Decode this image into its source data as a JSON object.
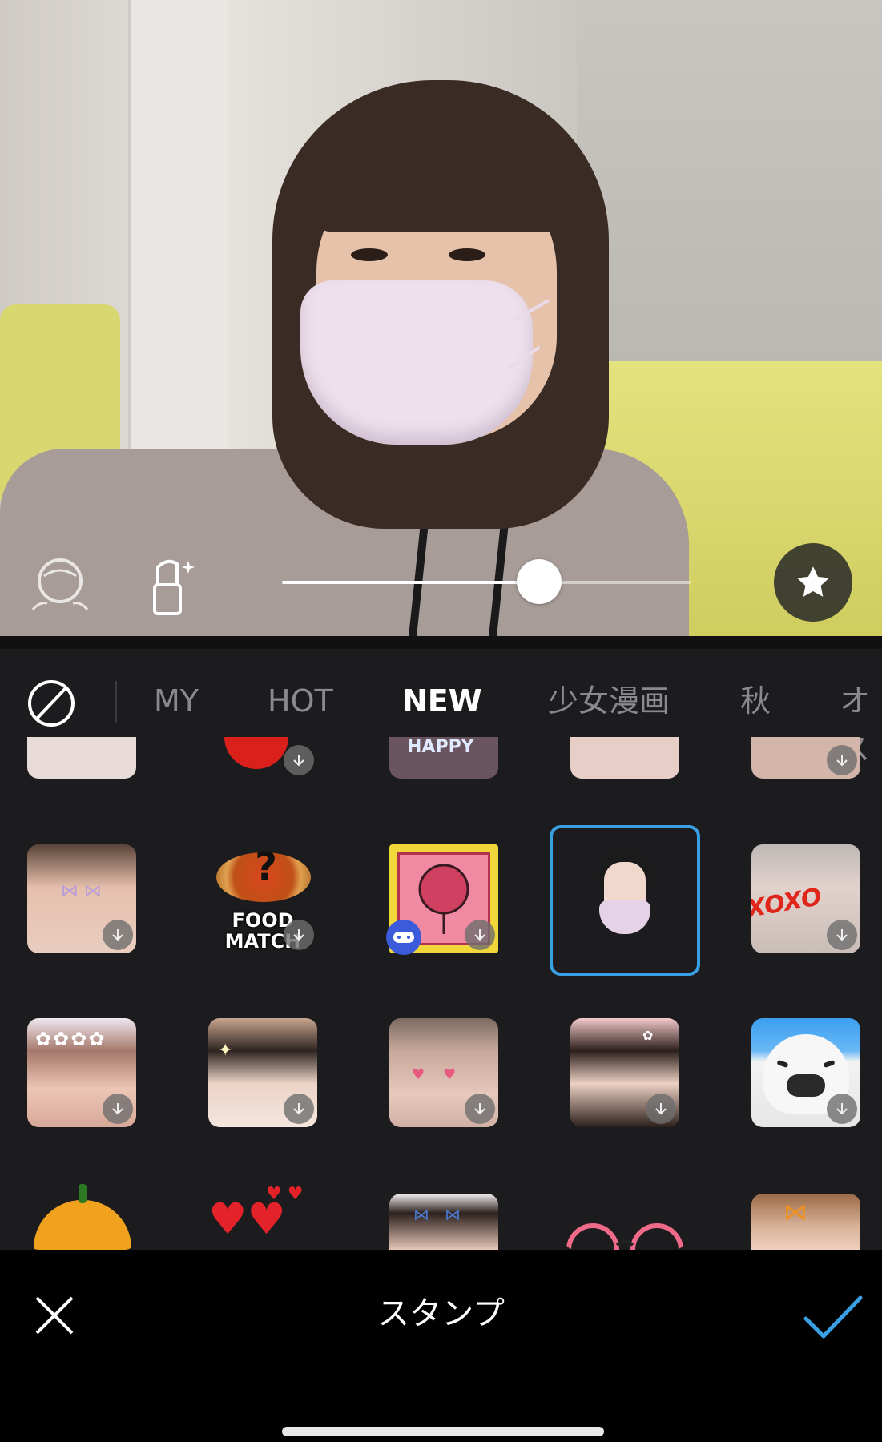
{
  "toolbar": {
    "slider_value": 0.63
  },
  "tabs": {
    "none_icon": "none-circle-slash-icon",
    "items": [
      "MY",
      "HOT",
      "NEW",
      "少女漫画",
      "秋",
      "オス"
    ],
    "active": "NEW"
  },
  "grid": {
    "row2": [
      {
        "name": "butterfly-face-sticker"
      },
      {
        "name": "food-match-sticker",
        "text": "FOOD\nMATCH",
        "game": false
      },
      {
        "name": "balloon-game-sticker",
        "game": true
      },
      {
        "name": "mask-sticker",
        "selected": true
      },
      {
        "name": "xoxo-kiss-sticker",
        "text": "XOXO"
      }
    ],
    "row3": [
      {
        "name": "flower-crown-sticker"
      },
      {
        "name": "sparkle-sticker"
      },
      {
        "name": "heart-cheek-sticker"
      },
      {
        "name": "flower-hair-sticker"
      },
      {
        "name": "seal-sticker"
      }
    ],
    "food_match_line1": "FOOD",
    "food_match_line2": "MATCH",
    "xoxo_text": "XOXO"
  },
  "bottom_bar": {
    "title": "スタンプ",
    "close_icon": "close-icon",
    "confirm_icon": "checkmark-icon"
  },
  "colors": {
    "accent": "#3aa0e6",
    "panel_bg": "#1c1c1e",
    "active_tab": "#ffffff",
    "inactive_tab": "#8a8a8e"
  }
}
